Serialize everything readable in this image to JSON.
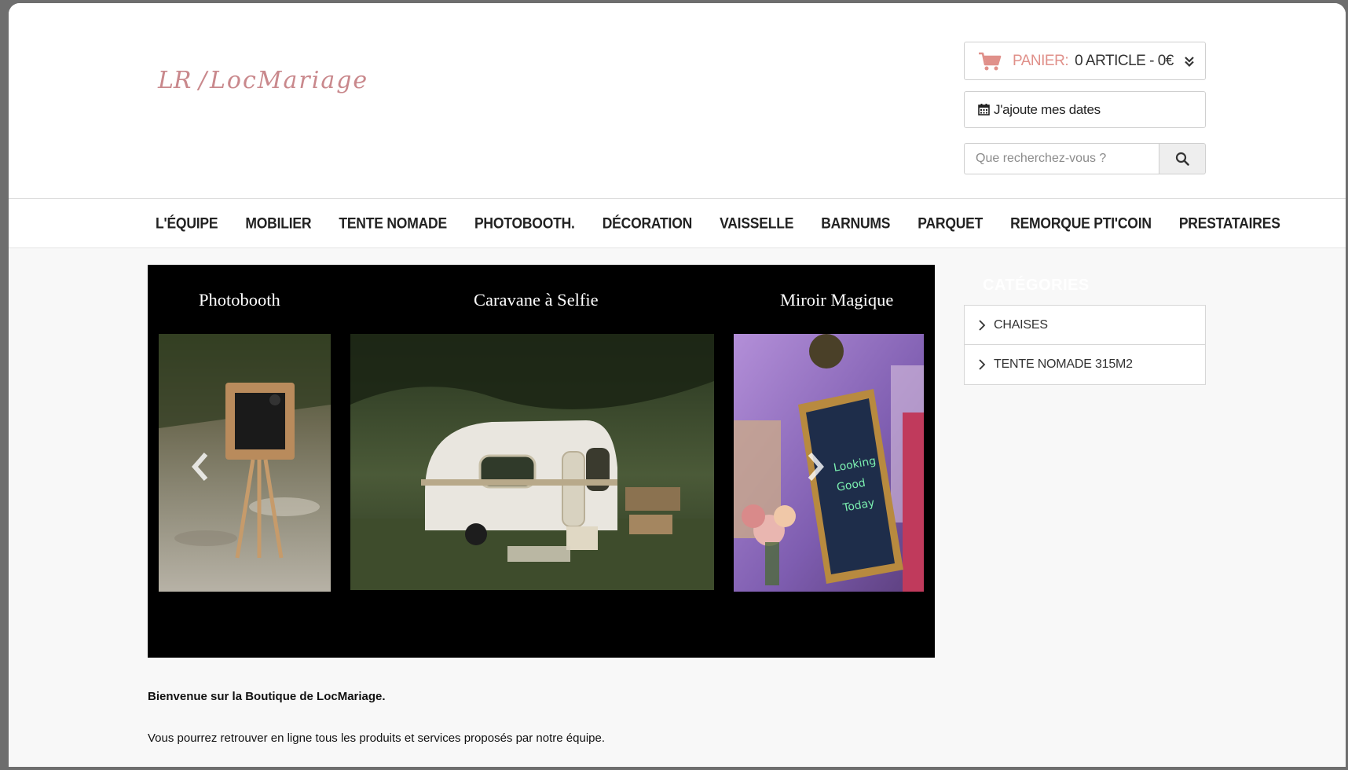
{
  "logo": {
    "text": "LocMariage",
    "initials": "LR"
  },
  "cart": {
    "label": "PANIER:",
    "value": "0 ARTICLE - 0€",
    "icon": "cart-icon"
  },
  "dates_button": {
    "label": "J'ajoute mes dates",
    "icon": "calendar-icon"
  },
  "search": {
    "placeholder": "Que recherchez-vous ?",
    "icon": "search-icon"
  },
  "nav": {
    "items": [
      "L'ÉQUIPE",
      "MOBILIER",
      "TENTE NOMADE",
      "PHOTOBOOTH.",
      "DÉCORATION",
      "VAISSELLE",
      "BARNUMS",
      "PARQUET",
      "REMORQUE PTI'COIN",
      "PRESTATAIRES"
    ]
  },
  "slider": {
    "titles": [
      "Photobooth",
      "Caravane à Selfie",
      "Miroir Magique"
    ],
    "mirror_text": [
      "Looking",
      "Good",
      "Today"
    ],
    "prev_icon": "chevron-left-icon",
    "next_icon": "chevron-right-icon"
  },
  "sidebar": {
    "title": "CATÉGORIES",
    "categories": [
      "CHAISES",
      "TENTE NOMADE 315M2"
    ]
  },
  "content": {
    "welcome": "Bienvenue sur la Boutique de LocMariage.",
    "intro": "Vous pourrez retrouver en ligne tous les produits et services proposés par notre équipe."
  },
  "colors": {
    "accent": "#e0908a",
    "logo": "#c9888c",
    "nav_text": "#222222"
  }
}
